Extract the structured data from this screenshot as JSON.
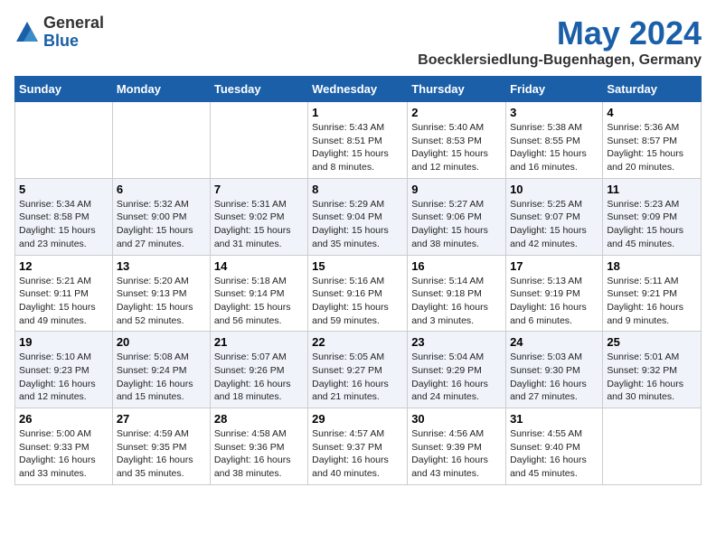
{
  "header": {
    "logo_general": "General",
    "logo_blue": "Blue",
    "title": "May 2024",
    "location": "Boecklersiedlung-Bugenhagen, Germany"
  },
  "days_of_week": [
    "Sunday",
    "Monday",
    "Tuesday",
    "Wednesday",
    "Thursday",
    "Friday",
    "Saturday"
  ],
  "weeks": [
    [
      {
        "day": "",
        "info": ""
      },
      {
        "day": "",
        "info": ""
      },
      {
        "day": "",
        "info": ""
      },
      {
        "day": "1",
        "info": "Sunrise: 5:43 AM\nSunset: 8:51 PM\nDaylight: 15 hours\nand 8 minutes."
      },
      {
        "day": "2",
        "info": "Sunrise: 5:40 AM\nSunset: 8:53 PM\nDaylight: 15 hours\nand 12 minutes."
      },
      {
        "day": "3",
        "info": "Sunrise: 5:38 AM\nSunset: 8:55 PM\nDaylight: 15 hours\nand 16 minutes."
      },
      {
        "day": "4",
        "info": "Sunrise: 5:36 AM\nSunset: 8:57 PM\nDaylight: 15 hours\nand 20 minutes."
      }
    ],
    [
      {
        "day": "5",
        "info": "Sunrise: 5:34 AM\nSunset: 8:58 PM\nDaylight: 15 hours\nand 23 minutes."
      },
      {
        "day": "6",
        "info": "Sunrise: 5:32 AM\nSunset: 9:00 PM\nDaylight: 15 hours\nand 27 minutes."
      },
      {
        "day": "7",
        "info": "Sunrise: 5:31 AM\nSunset: 9:02 PM\nDaylight: 15 hours\nand 31 minutes."
      },
      {
        "day": "8",
        "info": "Sunrise: 5:29 AM\nSunset: 9:04 PM\nDaylight: 15 hours\nand 35 minutes."
      },
      {
        "day": "9",
        "info": "Sunrise: 5:27 AM\nSunset: 9:06 PM\nDaylight: 15 hours\nand 38 minutes."
      },
      {
        "day": "10",
        "info": "Sunrise: 5:25 AM\nSunset: 9:07 PM\nDaylight: 15 hours\nand 42 minutes."
      },
      {
        "day": "11",
        "info": "Sunrise: 5:23 AM\nSunset: 9:09 PM\nDaylight: 15 hours\nand 45 minutes."
      }
    ],
    [
      {
        "day": "12",
        "info": "Sunrise: 5:21 AM\nSunset: 9:11 PM\nDaylight: 15 hours\nand 49 minutes."
      },
      {
        "day": "13",
        "info": "Sunrise: 5:20 AM\nSunset: 9:13 PM\nDaylight: 15 hours\nand 52 minutes."
      },
      {
        "day": "14",
        "info": "Sunrise: 5:18 AM\nSunset: 9:14 PM\nDaylight: 15 hours\nand 56 minutes."
      },
      {
        "day": "15",
        "info": "Sunrise: 5:16 AM\nSunset: 9:16 PM\nDaylight: 15 hours\nand 59 minutes."
      },
      {
        "day": "16",
        "info": "Sunrise: 5:14 AM\nSunset: 9:18 PM\nDaylight: 16 hours\nand 3 minutes."
      },
      {
        "day": "17",
        "info": "Sunrise: 5:13 AM\nSunset: 9:19 PM\nDaylight: 16 hours\nand 6 minutes."
      },
      {
        "day": "18",
        "info": "Sunrise: 5:11 AM\nSunset: 9:21 PM\nDaylight: 16 hours\nand 9 minutes."
      }
    ],
    [
      {
        "day": "19",
        "info": "Sunrise: 5:10 AM\nSunset: 9:23 PM\nDaylight: 16 hours\nand 12 minutes."
      },
      {
        "day": "20",
        "info": "Sunrise: 5:08 AM\nSunset: 9:24 PM\nDaylight: 16 hours\nand 15 minutes."
      },
      {
        "day": "21",
        "info": "Sunrise: 5:07 AM\nSunset: 9:26 PM\nDaylight: 16 hours\nand 18 minutes."
      },
      {
        "day": "22",
        "info": "Sunrise: 5:05 AM\nSunset: 9:27 PM\nDaylight: 16 hours\nand 21 minutes."
      },
      {
        "day": "23",
        "info": "Sunrise: 5:04 AM\nSunset: 9:29 PM\nDaylight: 16 hours\nand 24 minutes."
      },
      {
        "day": "24",
        "info": "Sunrise: 5:03 AM\nSunset: 9:30 PM\nDaylight: 16 hours\nand 27 minutes."
      },
      {
        "day": "25",
        "info": "Sunrise: 5:01 AM\nSunset: 9:32 PM\nDaylight: 16 hours\nand 30 minutes."
      }
    ],
    [
      {
        "day": "26",
        "info": "Sunrise: 5:00 AM\nSunset: 9:33 PM\nDaylight: 16 hours\nand 33 minutes."
      },
      {
        "day": "27",
        "info": "Sunrise: 4:59 AM\nSunset: 9:35 PM\nDaylight: 16 hours\nand 35 minutes."
      },
      {
        "day": "28",
        "info": "Sunrise: 4:58 AM\nSunset: 9:36 PM\nDaylight: 16 hours\nand 38 minutes."
      },
      {
        "day": "29",
        "info": "Sunrise: 4:57 AM\nSunset: 9:37 PM\nDaylight: 16 hours\nand 40 minutes."
      },
      {
        "day": "30",
        "info": "Sunrise: 4:56 AM\nSunset: 9:39 PM\nDaylight: 16 hours\nand 43 minutes."
      },
      {
        "day": "31",
        "info": "Sunrise: 4:55 AM\nSunset: 9:40 PM\nDaylight: 16 hours\nand 45 minutes."
      },
      {
        "day": "",
        "info": ""
      }
    ]
  ]
}
